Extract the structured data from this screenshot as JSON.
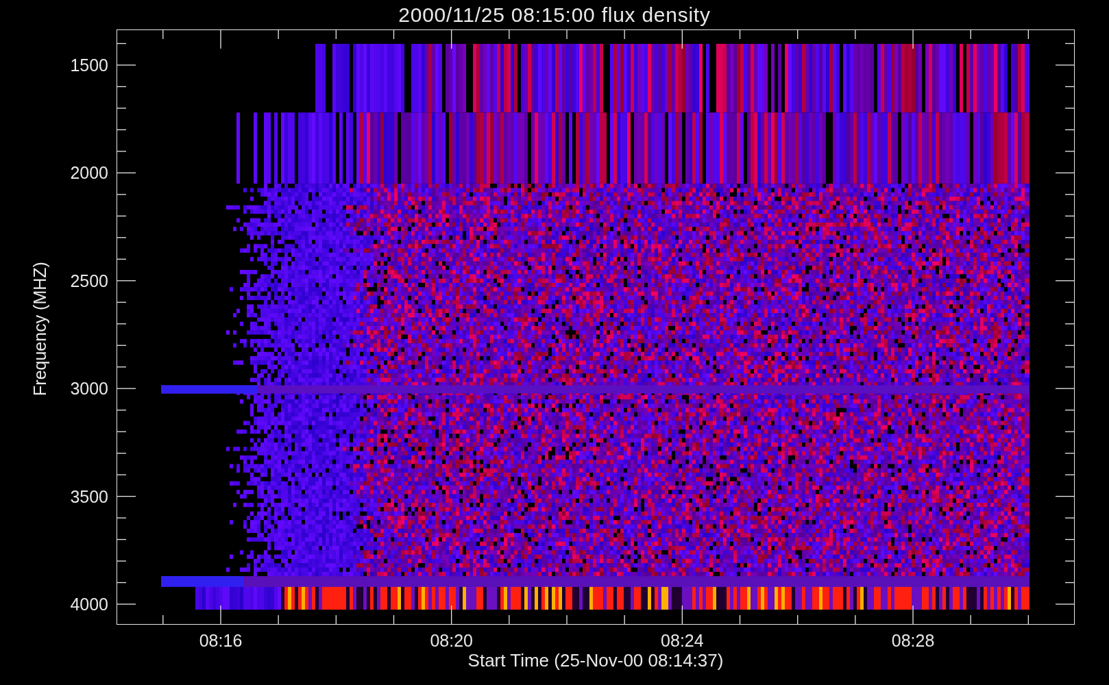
{
  "title": "2000/11/25 08:15:00 flux density",
  "y_axis": {
    "label": "Frequency (MHZ)",
    "ticks": [
      "1500",
      "2000",
      "2500",
      "3000",
      "3500",
      "4000"
    ]
  },
  "x_axis": {
    "label": "Start Time (25-Nov-00 08:14:37)",
    "ticks": [
      "08:16",
      "08:20",
      "08:24",
      "08:28"
    ]
  }
}
